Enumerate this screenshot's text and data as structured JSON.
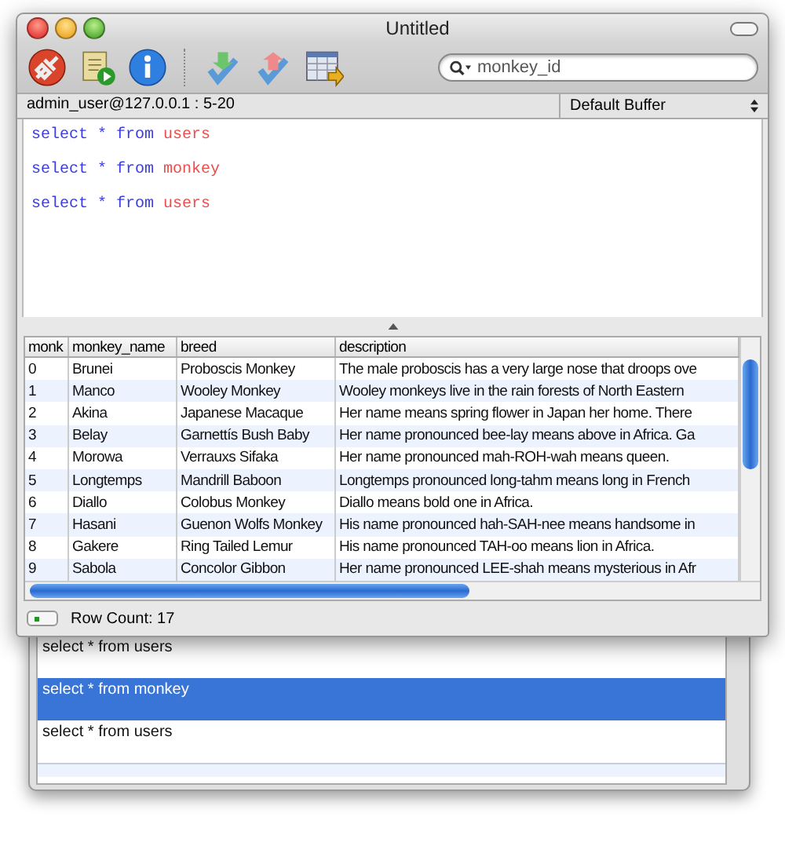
{
  "window": {
    "title": "Untitled"
  },
  "toolbar": {
    "search": {
      "value": "monkey_id"
    }
  },
  "info_bar": {
    "connection": "admin_user@127.0.0.1 : 5-20",
    "buffer": "Default Buffer"
  },
  "editor": {
    "lines": [
      {
        "tokens": [
          {
            "kind": "keyword",
            "text": "select * from"
          },
          {
            "kind": "table",
            "text": "users"
          }
        ]
      },
      {
        "tokens": [
          {
            "kind": "keyword",
            "text": "select * from"
          },
          {
            "kind": "table",
            "text": "monkey"
          }
        ]
      },
      {
        "tokens": [
          {
            "kind": "keyword",
            "text": "select * from"
          },
          {
            "kind": "table",
            "text": "users"
          }
        ]
      }
    ]
  },
  "table": {
    "columns": [
      "monk",
      "monkey_name",
      "breed",
      "description"
    ],
    "rows": [
      [
        "0",
        "Brunei",
        "Proboscis Monkey",
        "The male proboscis has a very large nose that droops ove"
      ],
      [
        "1",
        "Manco",
        "Wooley Monkey",
        "Wooley monkeys live in the rain forests of North Eastern"
      ],
      [
        "2",
        "Akina",
        "Japanese Macaque",
        "Her name means spring flower in Japan her home. There"
      ],
      [
        "3",
        "Belay",
        "Garnettís Bush Baby",
        "Her name pronounced bee-lay means above in Africa. Ga"
      ],
      [
        "4",
        "Morowa",
        "Verrauxs Sifaka",
        "Her name pronounced mah-ROH-wah means queen."
      ],
      [
        "5",
        "Longtemps",
        "Mandrill Baboon",
        "Longtemps pronounced long-tahm means long in French"
      ],
      [
        "6",
        "Diallo",
        "Colobus Monkey",
        "Diallo means bold one in Africa."
      ],
      [
        "7",
        "Hasani",
        "Guenon Wolfs Monkey",
        "His name pronounced hah-SAH-nee means handsome in"
      ],
      [
        "8",
        "Gakere",
        "Ring Tailed Lemur",
        "His name pronounced TAH-oo means lion in Africa."
      ],
      [
        "9",
        "Sabola",
        "Concolor Gibbon",
        "Her name pronounced LEE-shah means mysterious in Afr"
      ]
    ]
  },
  "status_bar": {
    "row_count": "Row Count: 17"
  },
  "history_drawer": {
    "items": [
      {
        "text": "select * from users",
        "selected": false
      },
      {
        "text": "select * from monkey",
        "selected": true
      },
      {
        "text": "select * from users",
        "selected": false
      }
    ]
  }
}
